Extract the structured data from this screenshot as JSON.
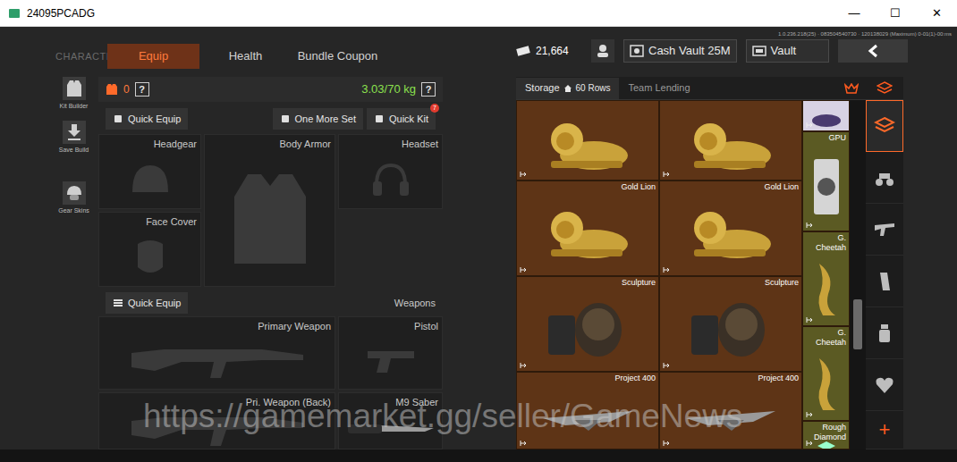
{
  "window": {
    "title": "24095PCADG",
    "controls": [
      "—",
      "☐",
      "✕"
    ]
  },
  "version": "1.0.236.218(25) · 083504540730 · 120138029 (Maximum) 0-01(1)-00:ms",
  "section_label": "CHARACTER",
  "tabs": [
    {
      "label": "Equip",
      "selected": true
    },
    {
      "label": "Health",
      "selected": false
    },
    {
      "label": "Bundle Coupon",
      "selected": false
    }
  ],
  "currency": {
    "amount": "21,664"
  },
  "top_buttons": [
    {
      "label": "Cash Vault 25M",
      "kind": "cash-vault"
    },
    {
      "label": "Vault",
      "kind": "vault"
    }
  ],
  "sidebar": [
    {
      "label": "Kit Builder",
      "kind": "kit"
    },
    {
      "label": "Save Build",
      "kind": "save"
    },
    {
      "label": "Gear Skins",
      "kind": "skins"
    }
  ],
  "loadout": {
    "armor_count": "0",
    "help": "?",
    "weight": "3.03/70 kg"
  },
  "gear_actions": [
    {
      "label": "Quick Equip",
      "badge": ""
    },
    {
      "label": "One More Set",
      "badge": ""
    },
    {
      "label": "Quick Kit",
      "badge": "7"
    }
  ],
  "gear_slots": [
    {
      "label": "Headgear",
      "kind": "helmet"
    },
    {
      "label": "Body Armor",
      "kind": "armor"
    },
    {
      "label": "Headset",
      "kind": "headset"
    },
    {
      "label": "Face Cover",
      "kind": "mask"
    }
  ],
  "weapons": {
    "quick_equip": "Quick Equip",
    "title": "Weapons",
    "slots": [
      {
        "label": "Primary Weapon",
        "kind": "rifle"
      },
      {
        "label": "Pistol",
        "kind": "pistol"
      },
      {
        "label": "Pri. Weapon (Back)",
        "kind": "rifle"
      },
      {
        "label": "M9 Saber",
        "kind": "knife"
      }
    ]
  },
  "storage": {
    "tabs": [
      {
        "label": "Storage",
        "detail": "60 Rows",
        "selected": true
      },
      {
        "label": "Team Lending",
        "detail": "",
        "selected": false
      }
    ],
    "rows": [
      {
        "items": [
          {
            "name": "",
            "kind": "lion"
          },
          {
            "name": "",
            "kind": "lion"
          }
        ]
      },
      {
        "items": [
          {
            "name": "Gold Lion",
            "kind": "lion"
          },
          {
            "name": "Gold Lion",
            "kind": "lion"
          }
        ]
      },
      {
        "items": [
          {
            "name": "Sculpture",
            "kind": "sculpture"
          },
          {
            "name": "Sculpture",
            "kind": "sculpture"
          }
        ]
      },
      {
        "items": [
          {
            "name": "Project 400",
            "kind": "plane"
          },
          {
            "name": "Project 400",
            "kind": "plane"
          }
        ]
      }
    ],
    "side_items": [
      {
        "name": "",
        "kind": "purple",
        "color": "#d8d2e4"
      },
      {
        "name": "GPU",
        "kind": "gpu",
        "color": "#5b5a23"
      },
      {
        "name": "G. Cheetah",
        "kind": "cheetah",
        "color": "#5b5a23"
      },
      {
        "name": "G. Cheetah",
        "kind": "cheetah",
        "color": "#5b5a23"
      },
      {
        "name": "Rough Diamond",
        "kind": "diamond",
        "color": "#5b5a23"
      }
    ],
    "scroll": {
      "position": 0.62
    }
  },
  "category_rail": [
    {
      "kind": "all",
      "selected": true,
      "label": ""
    },
    {
      "kind": "vehicle",
      "selected": false,
      "label": ""
    },
    {
      "kind": "rifle",
      "selected": false,
      "label": ""
    },
    {
      "kind": "magazine",
      "selected": false,
      "label": ""
    },
    {
      "kind": "supply",
      "selected": false,
      "label": ""
    },
    {
      "kind": "medical",
      "selected": false,
      "label": ""
    },
    {
      "kind": "add",
      "selected": false,
      "label": "+"
    }
  ],
  "watermark": "https://gamemarket.gg/seller/GameNews"
}
